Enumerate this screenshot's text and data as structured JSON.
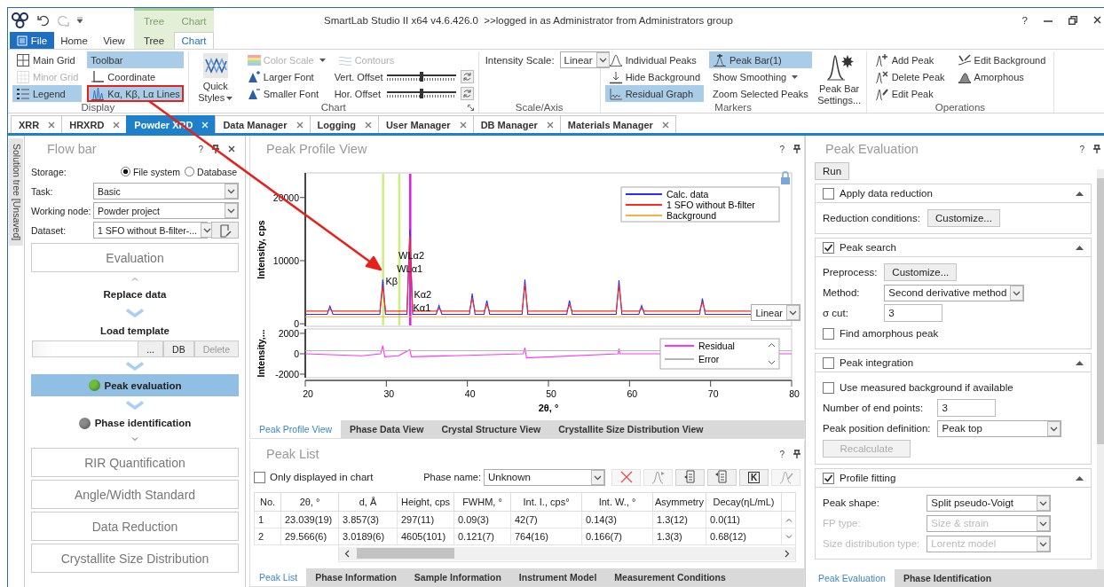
{
  "title_bar": {
    "context_tabs": [
      {
        "label": "Tree"
      },
      {
        "label": "Chart"
      }
    ],
    "title": "SmartLab Studio II x64 v4.6.426.0  >>logged in as Administrator from Administrators group",
    "help": "?"
  },
  "ribbon_tabs": [
    {
      "label": "File",
      "kind": "file",
      "selected": false
    },
    {
      "label": "Home",
      "kind": "plain",
      "selected": false
    },
    {
      "label": "View",
      "kind": "plain",
      "selected": false
    },
    {
      "label": "Tree",
      "kind": "context",
      "selected": false
    },
    {
      "label": "Chart",
      "kind": "context",
      "selected": true
    }
  ],
  "ribbon_groups": [
    {
      "title": "Display",
      "items": [
        {
          "kind": "toggle",
          "label": "Main Grid",
          "on": false,
          "disabled": false,
          "highlighted": false
        },
        {
          "kind": "toggle",
          "label": "Minor Grid",
          "on": false,
          "disabled": true,
          "highlighted": false
        },
        {
          "kind": "toggle",
          "label": "Legend",
          "on": true,
          "disabled": false,
          "highlighted": false
        },
        {
          "kind": "toggle",
          "label": "Toolbar",
          "on": true,
          "disabled": false,
          "highlighted": false
        },
        {
          "kind": "toggle",
          "label": "Coordinate",
          "on": false,
          "disabled": false,
          "highlighted": false
        },
        {
          "kind": "toggle",
          "label": "Kα, Kβ, Lα Lines",
          "on": true,
          "disabled": false,
          "highlighted": true
        }
      ]
    },
    {
      "title": "Chart",
      "launcher": true,
      "items": [
        {
          "kind": "large",
          "label": "Quick Styles",
          "dropdown": true
        },
        {
          "kind": "toggle",
          "label": "Color Scale",
          "on": false,
          "disabled": true,
          "dropdown": true
        },
        {
          "kind": "button",
          "label": "Larger Font"
        },
        {
          "kind": "button",
          "label": "Smaller Font"
        },
        {
          "kind": "toggle",
          "label": "Contours",
          "on": false,
          "disabled": true
        },
        {
          "kind": "slider",
          "label": "Vert. Offset",
          "level": 0.5
        },
        {
          "kind": "slider",
          "label": "Hor. Offset",
          "level": 0.5
        }
      ]
    },
    {
      "title": "Scale/Axis",
      "items": [
        {
          "kind": "select",
          "label": "Intensity Scale:",
          "value": "Linear"
        }
      ]
    },
    {
      "title": "Markers",
      "items": [
        {
          "kind": "toggle",
          "label": "Individual Peaks",
          "on": false
        },
        {
          "kind": "toggle",
          "label": "Hide Background",
          "on": false
        },
        {
          "kind": "toggle",
          "label": "Residual Graph",
          "on": true
        },
        {
          "kind": "toggle",
          "label": "Peak Bar(1)",
          "on": true
        },
        {
          "kind": "button",
          "label": "Show Smoothing",
          "dropdown": true
        },
        {
          "kind": "button",
          "label": "Zoom Selected Peaks"
        },
        {
          "kind": "large",
          "label": "Peak Bar Settings..."
        }
      ]
    },
    {
      "title": "Operations",
      "items": [
        {
          "kind": "button",
          "label": "Add Peak"
        },
        {
          "kind": "button",
          "label": "Delete Peak"
        },
        {
          "kind": "button",
          "label": "Edit Peak"
        },
        {
          "kind": "button",
          "label": "Edit Background"
        },
        {
          "kind": "button",
          "label": "Amorphous"
        }
      ]
    }
  ],
  "doc_tabs": [
    {
      "label": "XRR",
      "selected": false
    },
    {
      "label": "HRXRD",
      "selected": false
    },
    {
      "label": "Powder XRD",
      "selected": true
    },
    {
      "label": "Data Manager",
      "selected": false
    },
    {
      "label": "Logging",
      "selected": false
    },
    {
      "label": "User Manager",
      "selected": false
    },
    {
      "label": "DB Manager",
      "selected": false
    },
    {
      "label": "Materials Manager",
      "selected": false
    }
  ],
  "flow_bar": {
    "side_tab": "Solution tree [Unsaved]",
    "title": "Flow bar",
    "help": "?",
    "storage": {
      "label": "Storage:",
      "options": [
        {
          "label": "File system",
          "selected": true
        },
        {
          "label": "Database",
          "selected": false
        }
      ]
    },
    "fields": [
      {
        "label": "Task:",
        "value": "Basic",
        "action": false
      },
      {
        "label": "Working node:",
        "value": "Powder project",
        "action": false
      },
      {
        "label": "Dataset:",
        "value": "1 SFO without B-filter-...",
        "action": true
      }
    ],
    "steps": [
      {
        "kind": "section",
        "label": "Evaluation",
        "expanded": true
      },
      {
        "kind": "step",
        "label": "Replace data",
        "selected": false
      },
      {
        "kind": "template",
        "label": "Load template",
        "selected": false,
        "buttons": [
          {
            "label": "...",
            "disabled": false
          },
          {
            "label": "DB",
            "disabled": false
          },
          {
            "label": "Delete",
            "disabled": true
          }
        ]
      },
      {
        "kind": "step",
        "label": "Peak evaluation",
        "selected": true,
        "color": "#6cbf3a"
      },
      {
        "kind": "step",
        "label": "Phase identification",
        "selected": false,
        "color": "#8a8a8a"
      },
      {
        "kind": "section",
        "label": "RIR Quantification"
      },
      {
        "kind": "section",
        "label": "Angle/Width Standard"
      },
      {
        "kind": "section",
        "label": "Data Reduction"
      },
      {
        "kind": "section",
        "label": "Crystallite Size Distribution"
      }
    ]
  },
  "profile_view": {
    "title": "Peak Profile View",
    "help": "?",
    "scale": "Linear",
    "main_chart": {
      "chart_data": {
        "type": "line",
        "ylabel": "Intensity, cps",
        "xlim": [
          20,
          80
        ],
        "ylim": [
          -400,
          23900
        ],
        "yticks": [
          0,
          10000,
          20000
        ],
        "x": [
          20,
          22.7,
          23.04,
          23.4,
          29.2,
          29.57,
          29.9,
          32.55,
          32.9,
          33.25,
          36.15,
          36.5,
          36.85,
          40.25,
          40.6,
          40.95,
          42.05,
          42.4,
          42.75,
          46.75,
          47.1,
          47.45,
          52.25,
          52.6,
          52.95,
          58.35,
          58.7,
          59.05,
          61.15,
          61.5,
          61.85,
          68.65,
          69.0,
          69.35,
          75
        ],
        "series": [
          {
            "name": "Calc. data",
            "color": "#2b2bff",
            "values": [
              1500,
              1500,
              2800,
              1500,
              1500,
              7000,
              1500,
              1500,
              15000,
              1500,
              1500,
              2900,
              1500,
              1500,
              4800,
              1500,
              1500,
              3700,
              1500,
              1500,
              7000,
              1500,
              1500,
              3700,
              1500,
              1500,
              6900,
              1500,
              1500,
              2900,
              1500,
              1500,
              4000,
              1500,
              1500
            ]
          },
          {
            "name": "1 SFO without B-filter",
            "color": "#ff2a1a",
            "values": [
              2000,
              2000,
              2300,
              2000,
              2000,
              6000,
              2000,
              2000,
              14000,
              2000,
              2000,
              2400,
              2000,
              2000,
              4000,
              2000,
              2000,
              3000,
              2000,
              2000,
              6200,
              2000,
              2000,
              3000,
              2000,
              2000,
              6100,
              2000,
              2000,
              2400,
              2000,
              2000,
              3400,
              2000,
              2000
            ]
          },
          {
            "name": "Background",
            "color": "#f5b041",
            "values": [
              1100,
              1100,
              1100,
              1100,
              1100,
              1100,
              1100,
              1100,
              1100,
              1100,
              1100,
              1100,
              1100,
              1100,
              1100,
              1100,
              1100,
              1100,
              1100,
              1100,
              1100,
              1100,
              1100,
              1100,
              1100,
              1100,
              1100,
              1100,
              1100,
              1100,
              1100,
              1100,
              1100,
              1100,
              1100
            ]
          }
        ],
        "ref_lines": [
          {
            "axis": "x",
            "value": 29.6,
            "color": "#c9f07e"
          },
          {
            "axis": "x",
            "value": 31.6,
            "color": "#c9f07e"
          },
          {
            "axis": "x",
            "value": 32.95,
            "color": "#e020e0"
          }
        ],
        "annotations": [
          "Kβ",
          "WLα2",
          "WLα1",
          "Kα2",
          "Kα1"
        ],
        "legend": true
      }
    },
    "residual_chart": {
      "chart_data": {
        "type": "line",
        "ylabel": "Intensity,...",
        "xlabel": "2θ, °",
        "xlim": [
          20,
          80
        ],
        "ylim": [
          -2350,
          2430
        ],
        "yticks": [
          -2000,
          0,
          2000
        ],
        "xticks": [
          20,
          30,
          40,
          50,
          60,
          70,
          80
        ],
        "x": [
          20,
          27,
          29.3,
          29.57,
          29.8,
          31.5,
          32.9,
          33.1,
          46.9,
          47.1,
          47.3,
          58.6,
          58.7,
          58.8,
          80
        ],
        "series": [
          {
            "name": "Residual",
            "color": "#ff33ff",
            "values": [
              0,
              -200,
              0,
              800,
              -300,
              -200,
              400,
              -300,
              0,
              600,
              -400,
              0,
              500,
              0,
              0
            ]
          },
          {
            "name": "Error",
            "color": "#b5b5b5",
            "values": [
              300,
              300,
              300,
              300,
              300,
              300,
              300,
              300,
              300,
              300,
              300,
              300,
              300,
              300,
              300
            ]
          }
        ],
        "legend": true
      }
    },
    "tabs": [
      {
        "label": "Peak Profile View",
        "selected": true
      },
      {
        "label": "Phase Data View",
        "selected": false
      },
      {
        "label": "Crystal Structure View",
        "selected": false
      },
      {
        "label": "Crystallite Size Distribution View",
        "selected": false
      }
    ]
  },
  "peak_list": {
    "title": "Peak List",
    "help": "?",
    "only_displayed": {
      "label": "Only displayed in chart",
      "checked": false
    },
    "phase_label": "Phase name:",
    "phase_value": "Unknown",
    "tools": [
      {
        "disabled": true
      },
      {
        "disabled": true
      },
      {
        "disabled": false
      },
      {
        "disabled": false
      },
      {
        "label": "K",
        "disabled": false
      },
      {
        "disabled": true
      }
    ],
    "columns": [
      "No.",
      "2θ, °",
      "d, Å",
      "Height, cps",
      "FWHM, °",
      "Int. I., cps°",
      "Int. W., °",
      "Asymmetry",
      "Decay(ηL/mL)"
    ],
    "rows": [
      [
        "1",
        "23.039(19)",
        "3.857(3)",
        "297(11)",
        "0.09(3)",
        "42(7)",
        "0.14(3)",
        "1.3(12)",
        "0.0(11)"
      ],
      [
        "2",
        "29.566(6)",
        "3.0189(6)",
        "4605(101)",
        "0.121(7)",
        "764(16)",
        "0.166(7)",
        "1.3(3)",
        "0.68(12)"
      ]
    ],
    "tabs": [
      {
        "label": "Peak List",
        "selected": true
      },
      {
        "label": "Phase Information",
        "selected": false
      },
      {
        "label": "Sample Information",
        "selected": false
      },
      {
        "label": "Instrument Model",
        "selected": false
      },
      {
        "label": "Measurement Conditions",
        "selected": false
      }
    ]
  },
  "peak_evaluation": {
    "title": "Peak Evaluation",
    "help": "?",
    "run": "Run",
    "sections": [
      {
        "label": "Apply data reduction",
        "checked": false,
        "expanded": true,
        "rows": [
          {
            "kind": "button",
            "label": "Reduction conditions:",
            "value": "Customize...",
            "disabled": false
          }
        ]
      },
      {
        "label": "Peak search",
        "checked": true,
        "expanded": true,
        "rows": [
          {
            "kind": "button",
            "label": "Preprocess:",
            "value": "Customize...",
            "disabled": false
          },
          {
            "kind": "select",
            "label": "Method:",
            "value": "Second derivative method",
            "disabled": false
          },
          {
            "kind": "input",
            "label": "σ cut:",
            "value": "3",
            "disabled": false
          },
          {
            "kind": "checkbox",
            "label": "Find amorphous peak",
            "checked": false
          }
        ]
      },
      {
        "label": "Peak integration",
        "checked": false,
        "expanded": true,
        "rows": [
          {
            "kind": "checkbox",
            "label": "Use measured background if available",
            "checked": false
          },
          {
            "kind": "input",
            "label": "Number of end points:",
            "value": "3",
            "disabled": false
          },
          {
            "kind": "select",
            "label": "Peak position definition:",
            "value": "Peak top",
            "disabled": false
          },
          {
            "kind": "action",
            "value": "Recalculate",
            "disabled": true
          }
        ]
      },
      {
        "label": "Profile fitting",
        "checked": true,
        "expanded": true,
        "rows": [
          {
            "kind": "select",
            "label": "Peak shape:",
            "value": "Split pseudo-Voigt",
            "disabled": false
          },
          {
            "kind": "select",
            "label": "FP type:",
            "value": "Size & strain",
            "disabled": true
          },
          {
            "kind": "select",
            "label": "Size distribution type:",
            "value": "Lorentz model",
            "disabled": true
          }
        ]
      }
    ],
    "tabs": [
      {
        "label": "Peak Evaluation",
        "selected": true
      },
      {
        "label": "Phase Identification",
        "selected": false
      }
    ]
  }
}
